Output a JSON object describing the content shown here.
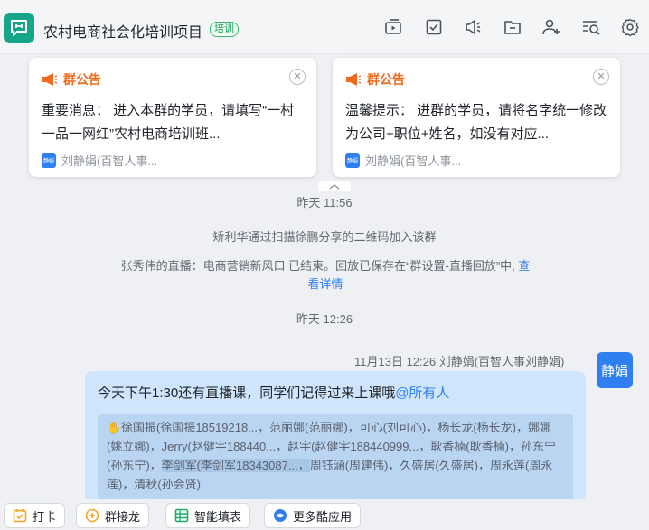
{
  "header": {
    "group_name": "农村电商社会化培训项目",
    "tag": "培训",
    "icons": [
      "live-icon",
      "task-check-icon",
      "announcement-icon",
      "folder-icon",
      "add-member-icon",
      "search-history-icon",
      "settings-icon"
    ]
  },
  "announcements": [
    {
      "label": "群公告",
      "text": "重要消息： 进入本群的学员，请填写“一村一品一网红”农村电商培训班...",
      "author": "刘静娟(百智人事..."
    },
    {
      "label": "群公告",
      "text": "温馨提示： 进群的学员，请将名字统一修改为公司+职位+姓名，如没有对应...",
      "author": "刘静娟(百智人事..."
    }
  ],
  "timeline": {
    "time1": "昨天 11:56",
    "join_msg": "矫利华通过扫描徐鹏分享的二维码加入该群",
    "live_msg": "张秀伟的直播：电商营销新风口 已结束。回放已保存在“群设置-直播回放”中,",
    "live_link": "查看详情",
    "time2": "昨天 12:26"
  },
  "message": {
    "meta": "11月13日 12:26  刘静娟(百智人事刘静娟)",
    "avatar_text": "静娟",
    "text": "今天下午1:30还有直播课，同学们记得过来上课哦",
    "mention": "@所有人",
    "quote_a": "徐国振(徐国振18519218...，范丽娜(范丽娜)，可心(刘可心)，杨长龙(杨长龙)，娜娜(姚立娜)，Jerry(赵健宇188440...，赵宇(赵健宇188440999...，耿香楠(耿香楠)，孙东宁(孙东宁)，",
    "quote_hl": "李剑军(李剑军18343087...，",
    "quote_b": "周钰涵(周建伟)，久盛居(久盛居)，周永莲(周永莲)，清秋(孙会贤)"
  },
  "toolbar": {
    "buttons": [
      {
        "label": "打卡",
        "icon": "checkin-icon"
      },
      {
        "label": "群接龙",
        "icon": "relay-icon"
      },
      {
        "label": "智能填表",
        "icon": "form-icon"
      },
      {
        "label": "更多酷应用",
        "icon": "more-apps-icon"
      }
    ]
  },
  "colors": {
    "accent": "#2f7ff0",
    "announcement": "#f26a1b",
    "group_avatar": "#17a58a",
    "bubble": "#cfe5fb"
  }
}
